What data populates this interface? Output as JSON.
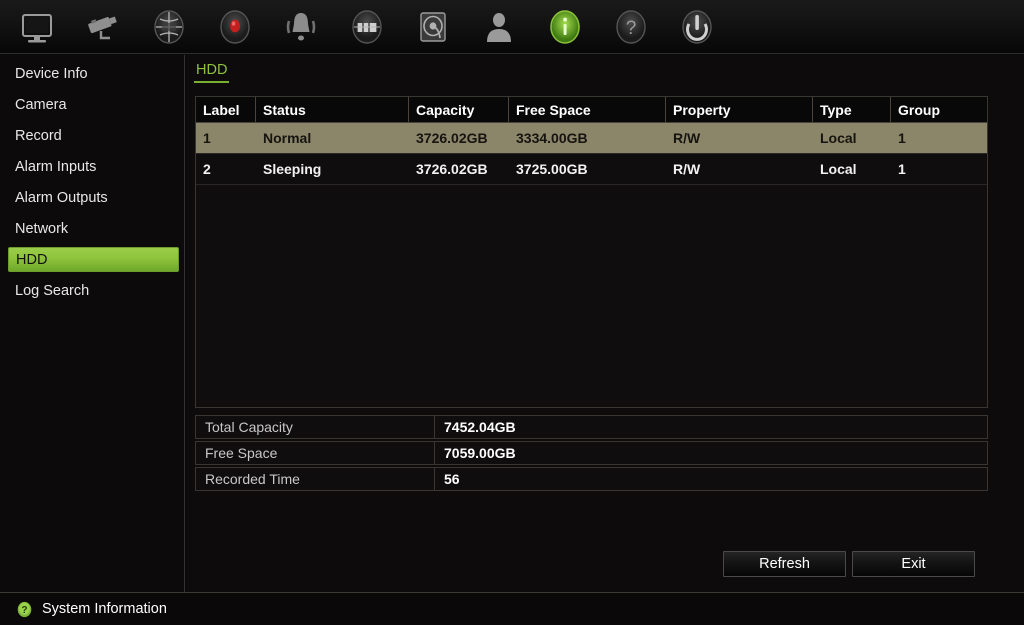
{
  "toolbar": {
    "icons": [
      {
        "name": "monitor-icon",
        "label": "Preview"
      },
      {
        "name": "camera-icon",
        "label": "Camera"
      },
      {
        "name": "globe-settings-icon",
        "label": "Configuration"
      },
      {
        "name": "record-icon",
        "label": "Record"
      },
      {
        "name": "alarm-bell-icon",
        "label": "Alarm"
      },
      {
        "name": "alarm-output-icon",
        "label": "Alarm Output"
      },
      {
        "name": "hdd-icon",
        "label": "HDD"
      },
      {
        "name": "user-icon",
        "label": "User"
      },
      {
        "name": "info-icon",
        "label": "System Information"
      },
      {
        "name": "help-icon",
        "label": "Help"
      },
      {
        "name": "power-icon",
        "label": "Shutdown"
      }
    ],
    "active_index": 8
  },
  "sidebar": {
    "items": [
      {
        "label": "Device Info",
        "name": "sidebar-item-device-info",
        "active": false
      },
      {
        "label": "Camera",
        "name": "sidebar-item-camera",
        "active": false
      },
      {
        "label": "Record",
        "name": "sidebar-item-record",
        "active": false
      },
      {
        "label": "Alarm Inputs",
        "name": "sidebar-item-alarm-inputs",
        "active": false
      },
      {
        "label": "Alarm Outputs",
        "name": "sidebar-item-alarm-outputs",
        "active": false
      },
      {
        "label": "Network",
        "name": "sidebar-item-network",
        "active": false
      },
      {
        "label": "HDD",
        "name": "sidebar-item-hdd",
        "active": true
      },
      {
        "label": "Log Search",
        "name": "sidebar-item-log-search",
        "active": false
      }
    ]
  },
  "main": {
    "tabs": [
      {
        "label": "HDD",
        "name": "tab-hdd",
        "active": true
      }
    ],
    "table": {
      "columns": [
        {
          "label": "Label",
          "key": "label",
          "class": "c-label"
        },
        {
          "label": "Status",
          "key": "status",
          "class": "c-status"
        },
        {
          "label": "Capacity",
          "key": "capacity",
          "class": "c-capacity"
        },
        {
          "label": "Free Space",
          "key": "free_space",
          "class": "c-free"
        },
        {
          "label": "Property",
          "key": "property",
          "class": "c-property"
        },
        {
          "label": "Type",
          "key": "type",
          "class": "c-type"
        },
        {
          "label": "Group",
          "key": "group",
          "class": "c-group"
        }
      ],
      "rows": [
        {
          "label": "1",
          "status": "Normal",
          "capacity": "3726.02GB",
          "free_space": "3334.00GB",
          "property": "R/W",
          "type": "Local",
          "group": "1",
          "selected": true
        },
        {
          "label": "2",
          "status": "Sleeping",
          "capacity": "3726.02GB",
          "free_space": "3725.00GB",
          "property": "R/W",
          "type": "Local",
          "group": "1",
          "selected": false
        }
      ]
    },
    "summary": [
      {
        "label": "Total Capacity",
        "value": "7452.04GB",
        "name": "summary-total-capacity"
      },
      {
        "label": "Free Space",
        "value": "7059.00GB",
        "name": "summary-free-space"
      },
      {
        "label": "Recorded Time",
        "value": "56",
        "name": "summary-recorded-time"
      }
    ],
    "buttons": {
      "refresh": "Refresh",
      "exit": "Exit"
    }
  },
  "statusbar": {
    "icon": "help-circle-icon",
    "text": "System Information"
  },
  "colors": {
    "accent_green": "#8ec33c",
    "selected_row": "#8b8569",
    "panel_bg": "#0d0b0c",
    "border": "#3a3632"
  }
}
